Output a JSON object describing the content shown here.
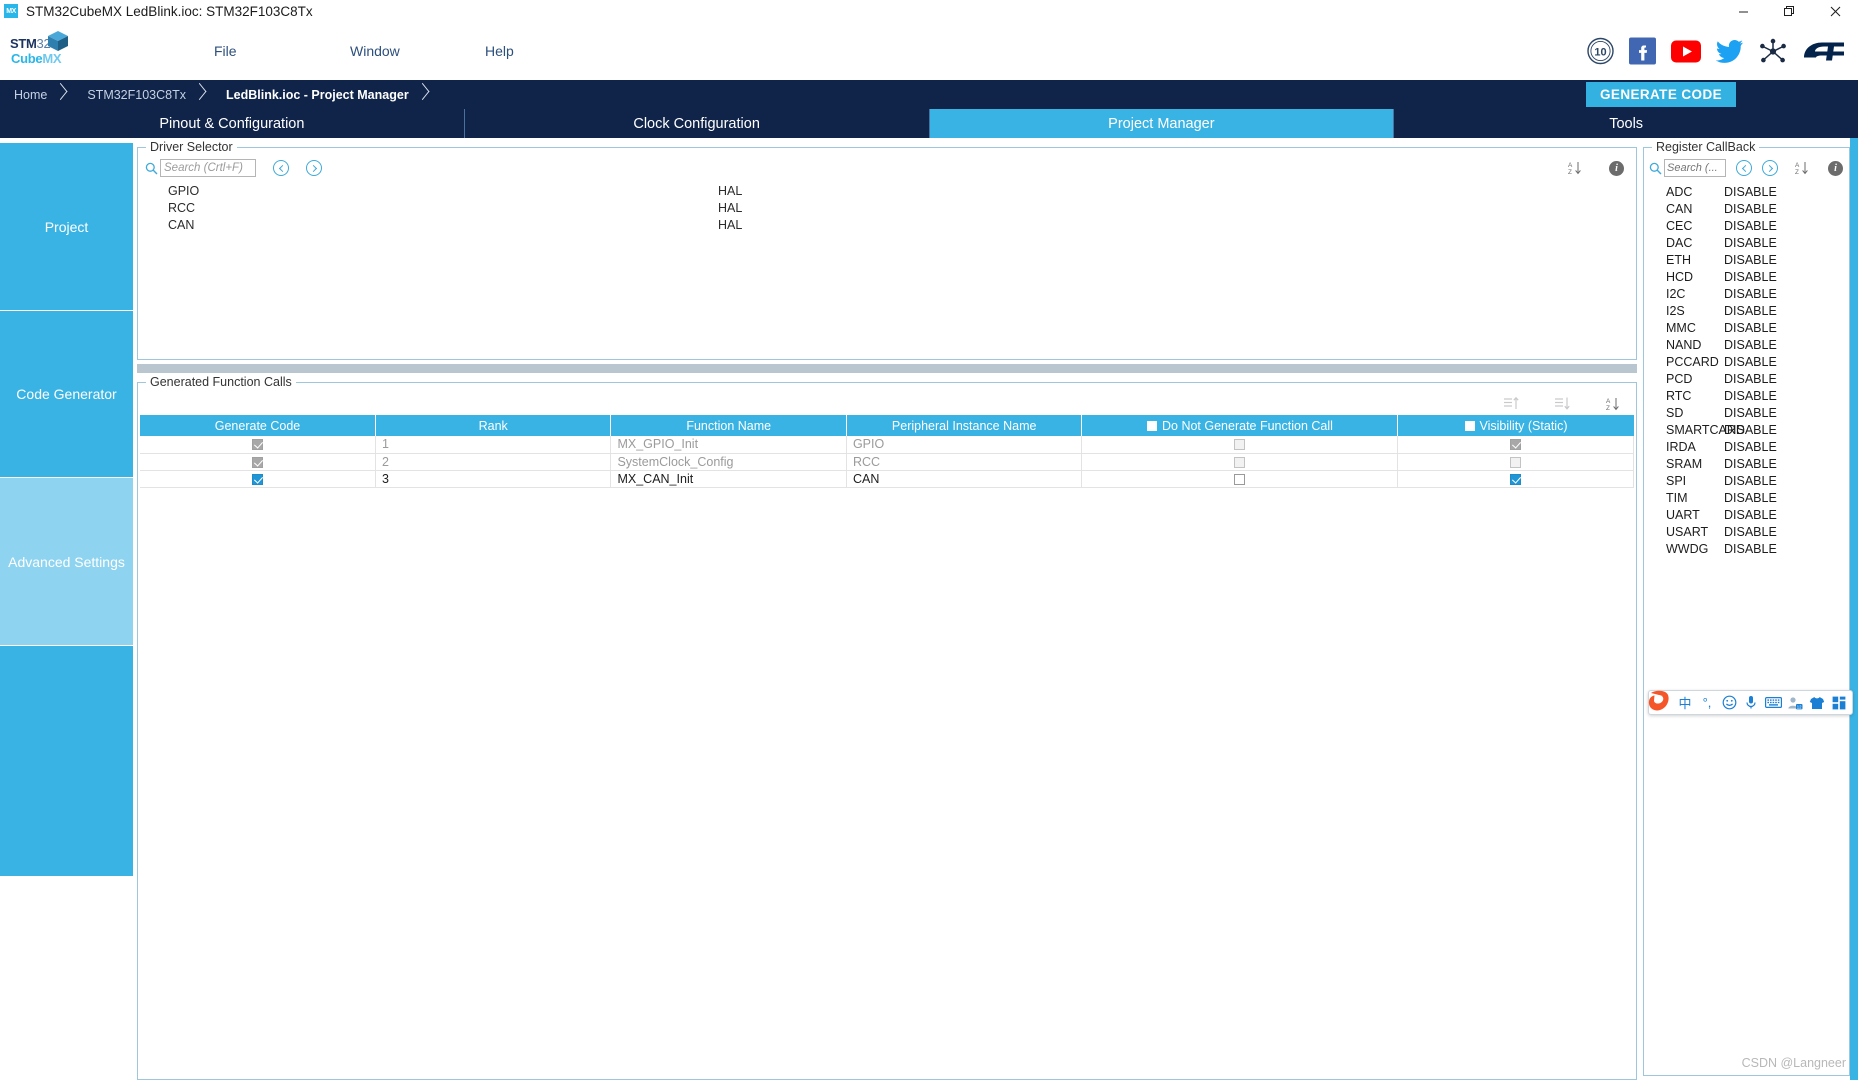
{
  "window": {
    "app_icon_label": "MX",
    "title": "STM32CubeMX LedBlink.ioc: STM32F103C8Tx",
    "minimize": "—",
    "restore": "❐",
    "close": "✕"
  },
  "logo": {
    "line1_main": "STM",
    "line1_num": "32",
    "line2_main": "Cube",
    "line2_suffix": "MX"
  },
  "menu": {
    "file": "File",
    "window": "Window",
    "help": "Help"
  },
  "social": {
    "badge": "10",
    "facebook": "f",
    "youtube": "▶",
    "twitter": "twitter-bird",
    "community": "st-community",
    "st_logo": "ST"
  },
  "breadcrumb": {
    "items": [
      {
        "label": "Home",
        "active": false
      },
      {
        "label": "STM32F103C8Tx",
        "active": false
      },
      {
        "label": "LedBlink.ioc - Project Manager",
        "active": true
      }
    ],
    "generate_code": "GENERATE CODE"
  },
  "main_tabs": [
    {
      "label": "Pinout & Configuration",
      "active": false
    },
    {
      "label": "Clock Configuration",
      "active": false
    },
    {
      "label": "Project Manager",
      "active": true
    },
    {
      "label": "Tools",
      "active": false
    }
  ],
  "sidebar": {
    "items": [
      {
        "label": "Project",
        "active": false
      },
      {
        "label": "Code Generator",
        "active": false
      },
      {
        "label": "Advanced Settings",
        "active": true
      }
    ]
  },
  "driver_selector": {
    "title": "Driver Selector",
    "search_placeholder": "Search (Crtl+F)",
    "search_value": "",
    "rows": [
      {
        "name": "GPIO",
        "mode": "HAL"
      },
      {
        "name": "RCC",
        "mode": "HAL"
      },
      {
        "name": "CAN",
        "mode": "HAL"
      }
    ]
  },
  "generated_function_calls": {
    "title": "Generated Function Calls",
    "columns": [
      {
        "label": "Generate Code",
        "checkbox": false
      },
      {
        "label": "Rank",
        "checkbox": false
      },
      {
        "label": "Function Name",
        "checkbox": false
      },
      {
        "label": "Peripheral Instance Name",
        "checkbox": false
      },
      {
        "label": "Do Not Generate Function Call",
        "checkbox": true
      },
      {
        "label": "Visibility (Static)",
        "checkbox": true
      }
    ],
    "rows": [
      {
        "generate_code": "checked-grey",
        "rank": "1",
        "function_name": "MX_GPIO_Init",
        "peripheral": "GPIO",
        "do_not_generate": "unchecked-dim",
        "visibility": "checked-grey",
        "dim": true
      },
      {
        "generate_code": "checked-grey",
        "rank": "2",
        "function_name": "SystemClock_Config",
        "peripheral": "RCC",
        "do_not_generate": "unchecked-dim",
        "visibility": "unchecked-dim",
        "dim": true
      },
      {
        "generate_code": "checked-blue",
        "rank": "3",
        "function_name": "MX_CAN_Init",
        "peripheral": "CAN",
        "do_not_generate": "unchecked",
        "visibility": "checked-blue",
        "dim": false
      }
    ]
  },
  "register_callback": {
    "title": "Register CallBack",
    "search_placeholder": "Search (...",
    "search_value": "",
    "rows": [
      {
        "name": "ADC",
        "value": "DISABLE"
      },
      {
        "name": "CAN",
        "value": "DISABLE"
      },
      {
        "name": "CEC",
        "value": "DISABLE"
      },
      {
        "name": "DAC",
        "value": "DISABLE"
      },
      {
        "name": "ETH",
        "value": "DISABLE"
      },
      {
        "name": "HCD",
        "value": "DISABLE"
      },
      {
        "name": "I2C",
        "value": "DISABLE"
      },
      {
        "name": "I2S",
        "value": "DISABLE"
      },
      {
        "name": "MMC",
        "value": "DISABLE"
      },
      {
        "name": "NAND",
        "value": "DISABLE"
      },
      {
        "name": "PCCARD",
        "value": "DISABLE"
      },
      {
        "name": "PCD",
        "value": "DISABLE"
      },
      {
        "name": "RTC",
        "value": "DISABLE"
      },
      {
        "name": "SD",
        "value": "DISABLE"
      },
      {
        "name": "SMARTCARD",
        "value": "DISABLE"
      },
      {
        "name": "IRDA",
        "value": "DISABLE"
      },
      {
        "name": "SRAM",
        "value": "DISABLE"
      },
      {
        "name": "SPI",
        "value": "DISABLE"
      },
      {
        "name": "TIM",
        "value": "DISABLE"
      },
      {
        "name": "UART",
        "value": "DISABLE"
      },
      {
        "name": "USART",
        "value": "DISABLE"
      },
      {
        "name": "WWDG",
        "value": "DISABLE"
      }
    ]
  },
  "ime_toolbar": {
    "logo": "S",
    "buttons": [
      {
        "name": "chinese-mode",
        "glyph": "中"
      },
      {
        "name": "punctuation-mode",
        "glyph": "°,"
      },
      {
        "name": "emoji",
        "glyph": "☺"
      },
      {
        "name": "voice-input",
        "glyph": "🎤"
      },
      {
        "name": "soft-keyboard",
        "glyph": "⌨"
      },
      {
        "name": "user-center",
        "glyph": "👤"
      },
      {
        "name": "skin",
        "glyph": "👕"
      },
      {
        "name": "toolbox",
        "glyph": "▦"
      }
    ]
  },
  "colors": {
    "accent_blue": "#39b3e3",
    "dark_navy": "#10244a",
    "sidebar_active": "#8ed3ef"
  },
  "watermark": "CSDN @Langneer"
}
